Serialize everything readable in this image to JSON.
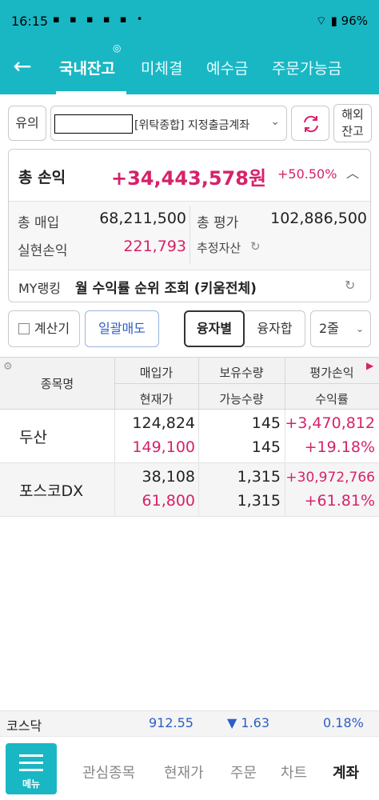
{
  "status_bar": {
    "time": "16:15",
    "battery": "96%"
  },
  "header": {
    "tabs": [
      {
        "label": "국내잔고",
        "active": true
      },
      {
        "label": "미체결",
        "active": false
      },
      {
        "label": "예수금",
        "active": false
      },
      {
        "label": "주문가능금",
        "active": false
      }
    ]
  },
  "account": {
    "type_label": "유의",
    "account_name": "[위탁종합] 지정출금계좌",
    "overseas_label": "해외\n잔고"
  },
  "summary": {
    "total_pl_label": "총 손익",
    "total_pl_value": "+34,443,578원",
    "total_pl_rate": "+50.50%",
    "purchase_label": "총 매입",
    "purchase_value": "68,211,500",
    "valuation_label": "총 평가",
    "valuation_value": "102,886,500",
    "realized_label": "실현손익",
    "realized_value": "221,793",
    "estimated_assets_label": "추정자산",
    "rank_label": "MY랭킹",
    "rank_text": "월 수익률 순위 조회 (키움전체)"
  },
  "actions": {
    "calculator_label": "계산기",
    "bulk_sell_label": "일괄매도",
    "by_loan_label": "융자별",
    "loan_total_label": "융자합",
    "rows_option": "2줄"
  },
  "table": {
    "headers": {
      "name": "종목명",
      "buy_price": "매입가",
      "current_price": "현재가",
      "holding_qty": "보유수량",
      "available_qty": "가능수량",
      "eval_pl": "평가손익",
      "return_rate": "수익률"
    },
    "rows": [
      {
        "name": "두산",
        "buy_price": "124,824",
        "current_price": "149,100",
        "holding_qty": "145",
        "available_qty": "145",
        "eval_pl": "+3,470,812",
        "return_rate": "+19.18%"
      },
      {
        "name": "포스코DX",
        "buy_price": "38,108",
        "current_price": "61,800",
        "holding_qty": "1,315",
        "available_qty": "1,315",
        "eval_pl": "+30,972,766",
        "return_rate": "+61.81%"
      }
    ]
  },
  "ticker": {
    "index_name": "코스닥",
    "value": "912.55",
    "change": "▼ 1.63",
    "rate": "0.18%"
  },
  "bottom_nav": {
    "menu_label": "메뉴",
    "items": [
      {
        "label": "관심종목",
        "active": false
      },
      {
        "label": "현재가",
        "active": false
      },
      {
        "label": "주문",
        "active": false
      },
      {
        "label": "차트",
        "active": false
      },
      {
        "label": "계좌",
        "active": true
      }
    ]
  },
  "colors": {
    "brand": "#19b7c4",
    "profit": "#d6226a",
    "loss": "#2c5ec6"
  }
}
